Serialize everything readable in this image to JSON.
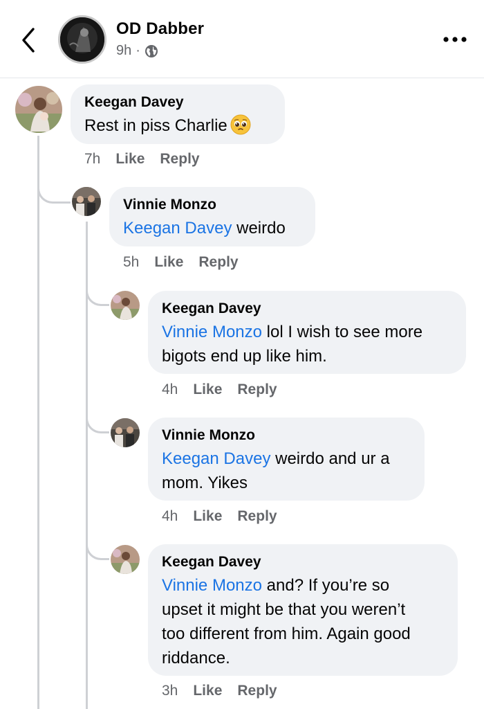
{
  "header": {
    "page_name": "OD Dabber",
    "time": "9h",
    "separator": "·",
    "back_icon": "chevron-left-icon",
    "privacy_icon": "globe-icon",
    "more_icon": "more-horizontal-icon"
  },
  "colors": {
    "mention": "#1b74e4",
    "bubble": "#f0f2f5",
    "muted": "#65676b",
    "thread_line": "#ced0d4"
  },
  "comments": [
    {
      "author": "Keegan Davey",
      "text": "Rest in piss Charlie",
      "emoji": "pleading-face-emoji",
      "time": "7h",
      "like": "Like",
      "reply": "Reply"
    }
  ],
  "replies": [
    {
      "author": "Vinnie Monzo",
      "mention": "Keegan Davey",
      "text": " weirdo",
      "time": "5h",
      "like": "Like",
      "reply": "Reply"
    },
    {
      "author": "Keegan Davey",
      "mention": "Vinnie Monzo",
      "text_line1": " lol I wish to see more",
      "text_line2": "bigots end up like him.",
      "time": "4h",
      "like": "Like",
      "reply": "Reply"
    },
    {
      "author": "Vinnie Monzo",
      "mention": "Keegan Davey",
      "text_line1": " weirdo and ur a",
      "text_line2": "mom. Yikes",
      "time": "4h",
      "like": "Like",
      "reply": "Reply"
    },
    {
      "author": "Keegan Davey",
      "mention": "Vinnie Monzo",
      "text_line1": " and?  If you’re so",
      "text_line2": "upset it might be that you weren’t",
      "text_line3": "too different from him. Again good",
      "text_line4": "riddance.",
      "time": "3h",
      "like": "Like",
      "reply": "Reply"
    }
  ]
}
